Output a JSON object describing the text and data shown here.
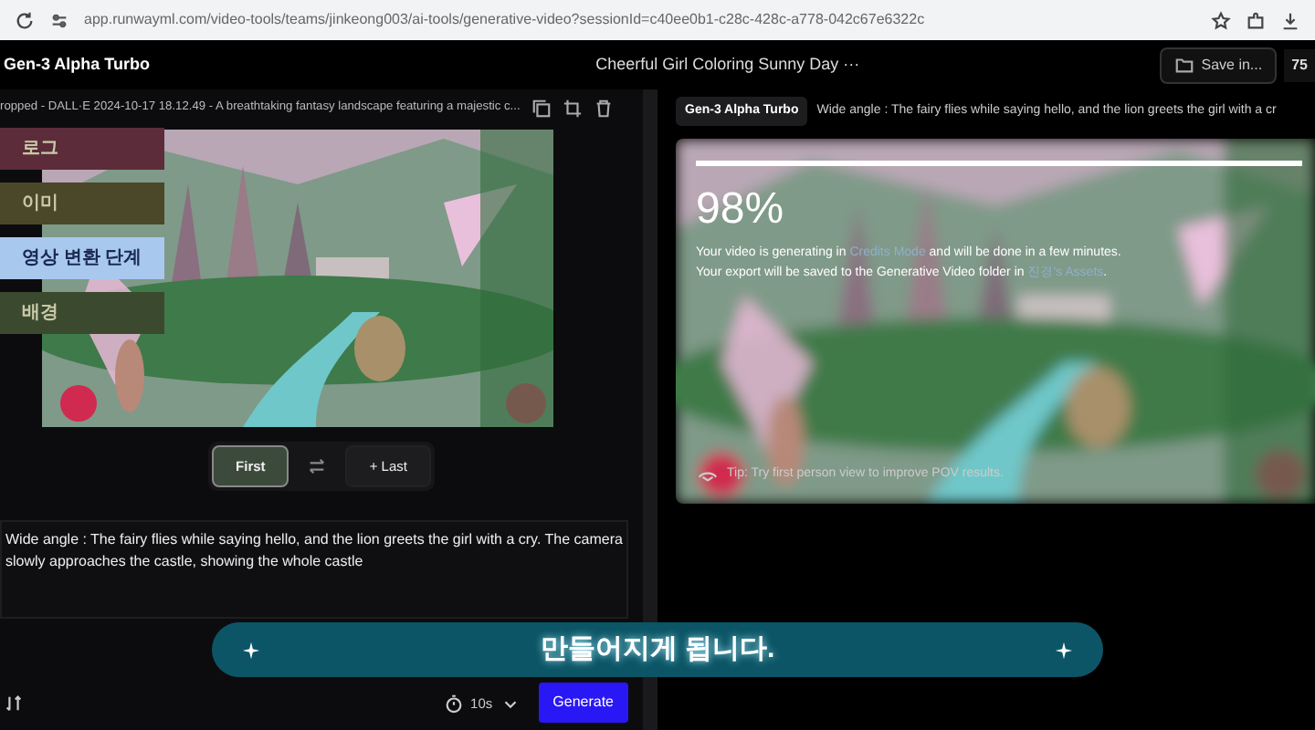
{
  "browser": {
    "url": "app.runwayml.com/video-tools/teams/jinkeong003/ai-tools/generative-video?sessionId=c40ee0b1-c28c-428c-a778-042c67e6322c"
  },
  "header": {
    "model": "Gen-3 Alpha Turbo",
    "title": "Cheerful Girl Coloring Sunny Day",
    "more": "···",
    "save_button": "Save in...",
    "credits": "75"
  },
  "left_panel": {
    "image_name": "ropped - DALL·E 2024-10-17 18.12.49 - A breathtaking fantasy landscape featuring a majestic c...",
    "frame_buttons": [
      {
        "label": "First",
        "selected": true
      },
      {
        "label": "+ Last",
        "selected": false
      }
    ],
    "prompt": "Wide angle : The fairy flies while saying hello, and the lion greets the girl with a cry. The camera slowly approaches the castle, showing the whole castle",
    "duration": "10s",
    "generate_button": "Generate"
  },
  "right_panel": {
    "model": "Gen-3 Alpha Turbo",
    "prompt": "Wide angle : The fairy flies while saying hello, and the lion greets the girl with a cr",
    "progress": {
      "level": 0.98,
      "percent": "98%"
    },
    "message_lines": [
      [
        {
          "kind": "text",
          "text": "Your video is generating in "
        },
        {
          "kind": "link",
          "text": "Credits Mode"
        },
        {
          "kind": "text",
          "text": " and will be done in a few minutes."
        }
      ],
      [
        {
          "kind": "text",
          "text": "Your export will be saved to the Generative Video folder in "
        },
        {
          "kind": "link",
          "text": "진경's Assets"
        },
        {
          "kind": "text",
          "text": "."
        }
      ]
    ],
    "tip": "Tip: Try first person view to improve POV results."
  },
  "overlay": {
    "chapters": [
      {
        "label": "로그",
        "selected": false,
        "color": "#5c2c3a"
      },
      {
        "label": "이미",
        "selected": false,
        "color": "#4a4828"
      },
      {
        "label": "영상 변환 단계",
        "selected": true,
        "color": "#a9c8ee"
      },
      {
        "label": "배경",
        "selected": false,
        "color": "#3b4a2e"
      }
    ],
    "subtitle": "만들어지게 됩니다."
  }
}
